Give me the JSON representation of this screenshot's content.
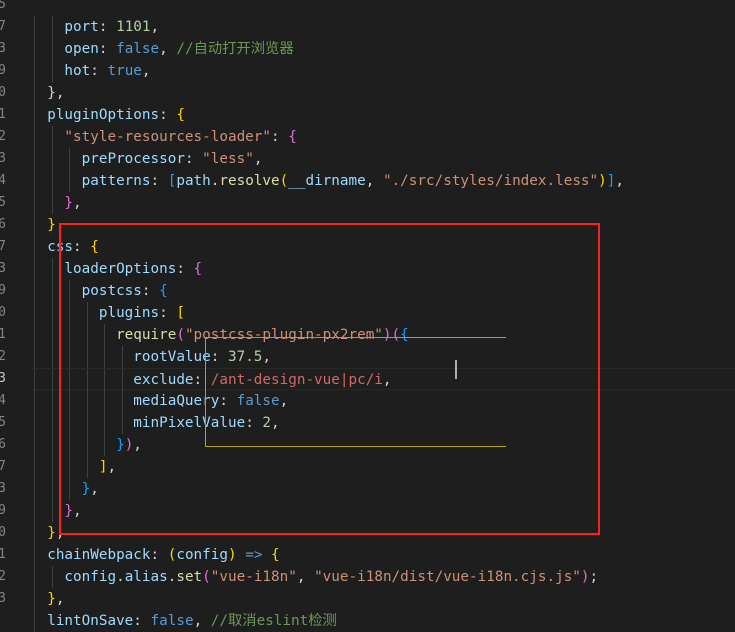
{
  "gutter": {
    "line_numbers": [
      "5",
      "7",
      "3",
      "9",
      "0",
      "1",
      "2",
      "3",
      "4",
      "5",
      "6",
      "7",
      "3",
      "9",
      "0",
      "1",
      "2",
      "3",
      "4",
      "5",
      "6",
      "7",
      "3",
      "9",
      "0",
      "1",
      "2",
      "3"
    ]
  },
  "code": {
    "lines": [
      [],
      [
        [
          "k",
          "    port"
        ],
        [
          "p",
          ": "
        ],
        [
          "n",
          "1101"
        ],
        [
          "p",
          ","
        ]
      ],
      [
        [
          "k",
          "    open"
        ],
        [
          "p",
          ": "
        ],
        [
          "b",
          "false"
        ],
        [
          "p",
          ", "
        ],
        [
          "c",
          "//自动打开浏览器"
        ]
      ],
      [
        [
          "k",
          "    hot"
        ],
        [
          "p",
          ": "
        ],
        [
          "b",
          "true"
        ],
        [
          "p",
          ","
        ]
      ],
      [
        [
          "p",
          "  },"
        ]
      ],
      [
        [
          "k",
          "  pluginOptions"
        ],
        [
          "p",
          ": "
        ],
        [
          "y",
          "{"
        ]
      ],
      [
        [
          "s",
          "    \"style-resources-loader\""
        ],
        [
          "p",
          ": "
        ],
        [
          "m",
          "{"
        ]
      ],
      [
        [
          "k",
          "      preProcessor"
        ],
        [
          "p",
          ": "
        ],
        [
          "s",
          "\"less\""
        ],
        [
          "p",
          ","
        ]
      ],
      [
        [
          "k",
          "      patterns"
        ],
        [
          "p",
          ": "
        ],
        [
          "bl",
          "["
        ],
        [
          "k",
          "path"
        ],
        [
          "p",
          "."
        ],
        [
          "f",
          "resolve"
        ],
        [
          "y",
          "("
        ],
        [
          "k",
          "__dirname"
        ],
        [
          "p",
          ", "
        ],
        [
          "s",
          "\"./src/styles/index.less\""
        ],
        [
          "y",
          ")"
        ],
        [
          "bl",
          "]"
        ],
        [
          "p",
          ","
        ]
      ],
      [
        [
          "m",
          "    }"
        ],
        [
          "p",
          ","
        ]
      ],
      [
        [
          "y",
          "  }"
        ],
        [
          "p",
          ","
        ]
      ],
      [
        [
          "k",
          "  css"
        ],
        [
          "p",
          ": "
        ],
        [
          "y",
          "{"
        ]
      ],
      [
        [
          "k",
          "    loaderOptions"
        ],
        [
          "p",
          ": "
        ],
        [
          "m",
          "{"
        ]
      ],
      [
        [
          "k",
          "      postcss"
        ],
        [
          "p",
          ": "
        ],
        [
          "bl",
          "{"
        ]
      ],
      [
        [
          "k",
          "        plugins"
        ],
        [
          "p",
          ": "
        ],
        [
          "y",
          "["
        ]
      ],
      [
        [
          "f",
          "          require"
        ],
        [
          "m",
          "("
        ],
        [
          "s",
          "\"postcss-plugin-px2rem\""
        ],
        [
          "m",
          ")"
        ],
        [
          "m",
          "("
        ],
        [
          "bl",
          "{"
        ]
      ],
      [
        [
          "k",
          "            rootValue"
        ],
        [
          "p",
          ": "
        ],
        [
          "n",
          "37.5"
        ],
        [
          "p",
          ","
        ]
      ],
      [
        [
          "k",
          "            exclude"
        ],
        [
          "p",
          ": "
        ],
        [
          "rx",
          "/ant-design-vue|pc/i"
        ],
        [
          "p",
          ","
        ]
      ],
      [
        [
          "k",
          "            mediaQuery"
        ],
        [
          "p",
          ": "
        ],
        [
          "b",
          "false"
        ],
        [
          "p",
          ","
        ]
      ],
      [
        [
          "k",
          "            minPixelValue"
        ],
        [
          "p",
          ": "
        ],
        [
          "n",
          "2"
        ],
        [
          "p",
          ","
        ]
      ],
      [
        [
          "bl",
          "          }"
        ],
        [
          "m",
          ")"
        ],
        [
          "p",
          ","
        ]
      ],
      [
        [
          "y",
          "        ]"
        ],
        [
          "p",
          ","
        ]
      ],
      [
        [
          "bl",
          "      }"
        ],
        [
          "p",
          ","
        ]
      ],
      [
        [
          "m",
          "    }"
        ],
        [
          "p",
          ","
        ]
      ],
      [
        [
          "y",
          "  }"
        ],
        [
          "p",
          ","
        ]
      ],
      [
        [
          "k",
          "  chainWebpack"
        ],
        [
          "p",
          ": "
        ],
        [
          "y",
          "("
        ],
        [
          "k",
          "config"
        ],
        [
          "y",
          ")"
        ],
        [
          "b",
          " =>"
        ],
        [
          "p",
          " "
        ],
        [
          "y",
          "{"
        ]
      ],
      [
        [
          "k",
          "    config"
        ],
        [
          "p",
          "."
        ],
        [
          "k",
          "alias"
        ],
        [
          "p",
          "."
        ],
        [
          "f",
          "set"
        ],
        [
          "m",
          "("
        ],
        [
          "s",
          "\"vue-i18n\""
        ],
        [
          "p",
          ", "
        ],
        [
          "s",
          "\"vue-i18n/dist/vue-i18n.cjs.js\""
        ],
        [
          "m",
          ")"
        ],
        [
          "p",
          ";"
        ]
      ],
      [
        [
          "y",
          "  }"
        ],
        [
          "p",
          ","
        ]
      ],
      [
        [
          "k",
          "  lintOnSave"
        ],
        [
          "p",
          ": "
        ],
        [
          "b",
          "false"
        ],
        [
          "p",
          ", "
        ],
        [
          "c",
          "//取消eslint检测"
        ]
      ]
    ]
  }
}
